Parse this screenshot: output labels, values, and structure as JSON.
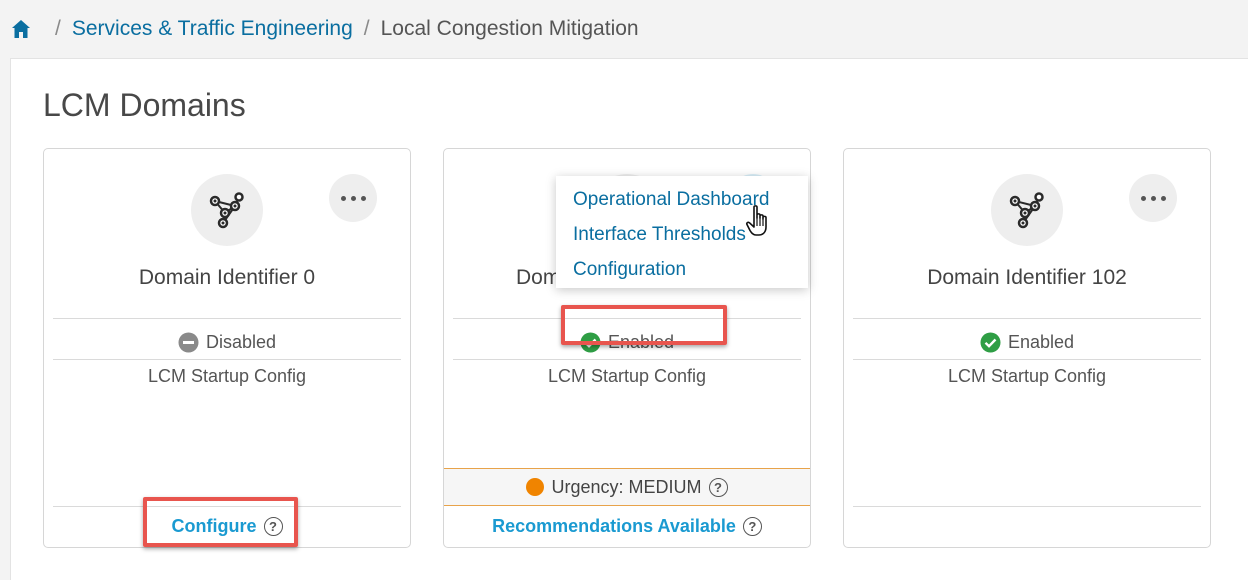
{
  "breadcrumb": {
    "items": [
      "Services & Traffic Engineering"
    ],
    "current": "Local Congestion Mitigation"
  },
  "page": {
    "title": "LCM Domains"
  },
  "cards": [
    {
      "name": "Domain Identifier 0",
      "status": "Disabled",
      "status_icon": "minus-circle-icon",
      "startup": "LCM Startup Config",
      "footer_link": "Configure"
    },
    {
      "name": "Domain Identifier",
      "name_visible": "Doma",
      "status": "Enabled",
      "status_icon": "check-circle-icon",
      "startup": "LCM Startup Config",
      "urgency": "Urgency: MEDIUM",
      "footer_link": "Recommendations Available"
    },
    {
      "name": "Domain Identifier 102",
      "status": "Enabled",
      "status_icon": "check-circle-icon",
      "startup": "LCM Startup Config"
    }
  ],
  "menu": {
    "items": [
      "Operational Dashboard",
      "Interface Thresholds",
      "Configuration"
    ]
  },
  "colors": {
    "link": "#0a6ea0",
    "link_bold": "#1a9ad1",
    "success": "#2f9e45",
    "disabled": "#8a8a8a",
    "urgency_medium": "#f08400",
    "highlight": "#e8554e"
  }
}
